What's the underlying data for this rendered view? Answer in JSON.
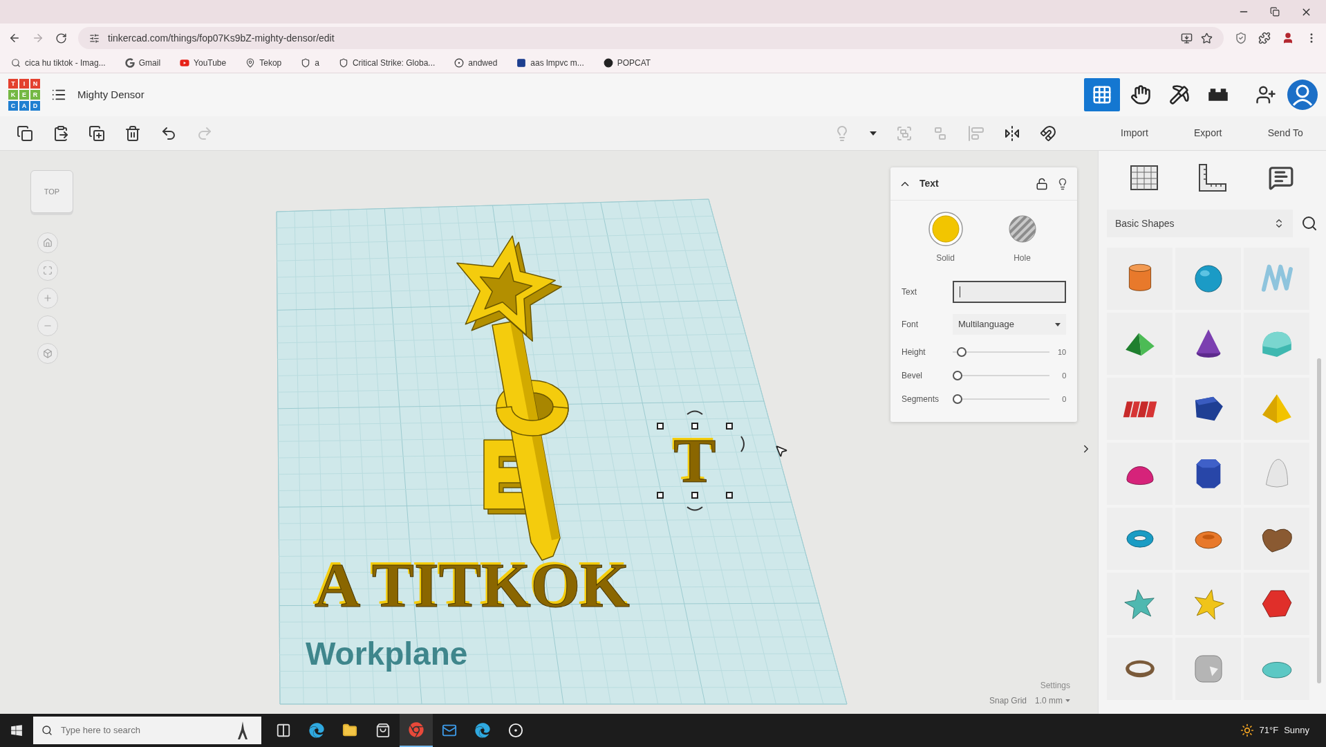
{
  "browser": {
    "url": "tinkercad.com/things/fop07Ks9bZ-mighty-densor/edit",
    "bookmarks": [
      {
        "kind": "search",
        "label": "cica hu tiktok - Imag..."
      },
      {
        "kind": "google",
        "label": "Gmail"
      },
      {
        "kind": "video",
        "label": "YouTube"
      },
      {
        "kind": "pin",
        "label": "Tekop"
      },
      {
        "kind": "shield",
        "label": "a"
      },
      {
        "kind": "shield",
        "label": "Critical Strike: Globa..."
      },
      {
        "kind": "ring",
        "label": "andwed"
      },
      {
        "kind": "square",
        "label": "aas lmpvc m..."
      },
      {
        "kind": "disc",
        "label": "POPCAT"
      }
    ]
  },
  "app": {
    "logo": [
      [
        "T",
        "I",
        "N"
      ],
      [
        "K",
        "E",
        "R"
      ],
      [
        "C",
        "A",
        "D"
      ]
    ],
    "project_name": "Mighty Densor",
    "modes": [
      {
        "kind": "grid",
        "selected": true
      },
      {
        "kind": "hands",
        "selected": false
      },
      {
        "kind": "pickaxe",
        "selected": false
      },
      {
        "kind": "bricks",
        "selected": false
      }
    ]
  },
  "toolbar": {
    "edit_tools": [
      {
        "kind": "copy",
        "disabled": false
      },
      {
        "kind": "paste",
        "disabled": false
      },
      {
        "kind": "duplicate",
        "disabled": false
      },
      {
        "kind": "delete",
        "disabled": false
      },
      {
        "kind": "undo",
        "disabled": false
      },
      {
        "kind": "redo",
        "disabled": true
      }
    ],
    "view_tools": [
      {
        "kind": "bulb",
        "disabled": true
      },
      {
        "kind": "caret",
        "disabled": false
      },
      {
        "kind": "group",
        "disabled": true
      },
      {
        "kind": "ungroup",
        "disabled": true
      },
      {
        "kind": "align",
        "disabled": true
      },
      {
        "kind": "mirror",
        "disabled": false
      },
      {
        "kind": "cruise",
        "disabled": false
      }
    ],
    "actions": [
      "Import",
      "Export",
      "Send To"
    ]
  },
  "canvas": {
    "view_cube": "TOP",
    "text_object": "A TITKOK",
    "selected_object": "T",
    "workplane_label": "Workplane",
    "snap": {
      "settings": "Settings",
      "label": "Snap Grid",
      "value": "1.0 mm"
    }
  },
  "inspector": {
    "title": "Text",
    "expanded": true,
    "locked": false,
    "fill_options": [
      {
        "kind": "solid",
        "label": "Solid",
        "selected": true
      },
      {
        "kind": "hole",
        "label": "Hole",
        "selected": false
      }
    ],
    "text_field": {
      "label": "Text",
      "focused": true
    },
    "font": {
      "label": "Font",
      "value": "Multilanguage"
    },
    "sliders": [
      {
        "label": "Height",
        "level": 0.05,
        "reading": "10"
      },
      {
        "label": "Bevel",
        "level": 0,
        "reading": "0"
      },
      {
        "label": "Segments",
        "level": 0,
        "reading": "0"
      }
    ]
  },
  "library": {
    "category": "Basic Shapes"
  },
  "taskbar": {
    "search_placeholder": "Type here to search",
    "apps": [
      {
        "kind": "taskview",
        "selected": false
      },
      {
        "kind": "edge",
        "selected": false
      },
      {
        "kind": "folder",
        "selected": false
      },
      {
        "kind": "store",
        "selected": false
      },
      {
        "kind": "chrome",
        "selected": true
      },
      {
        "kind": "mail",
        "selected": false
      },
      {
        "kind": "edge",
        "selected": false
      },
      {
        "kind": "disc",
        "selected": false
      }
    ],
    "weather": {
      "temperature": "71°F",
      "condition": "Sunny"
    }
  }
}
